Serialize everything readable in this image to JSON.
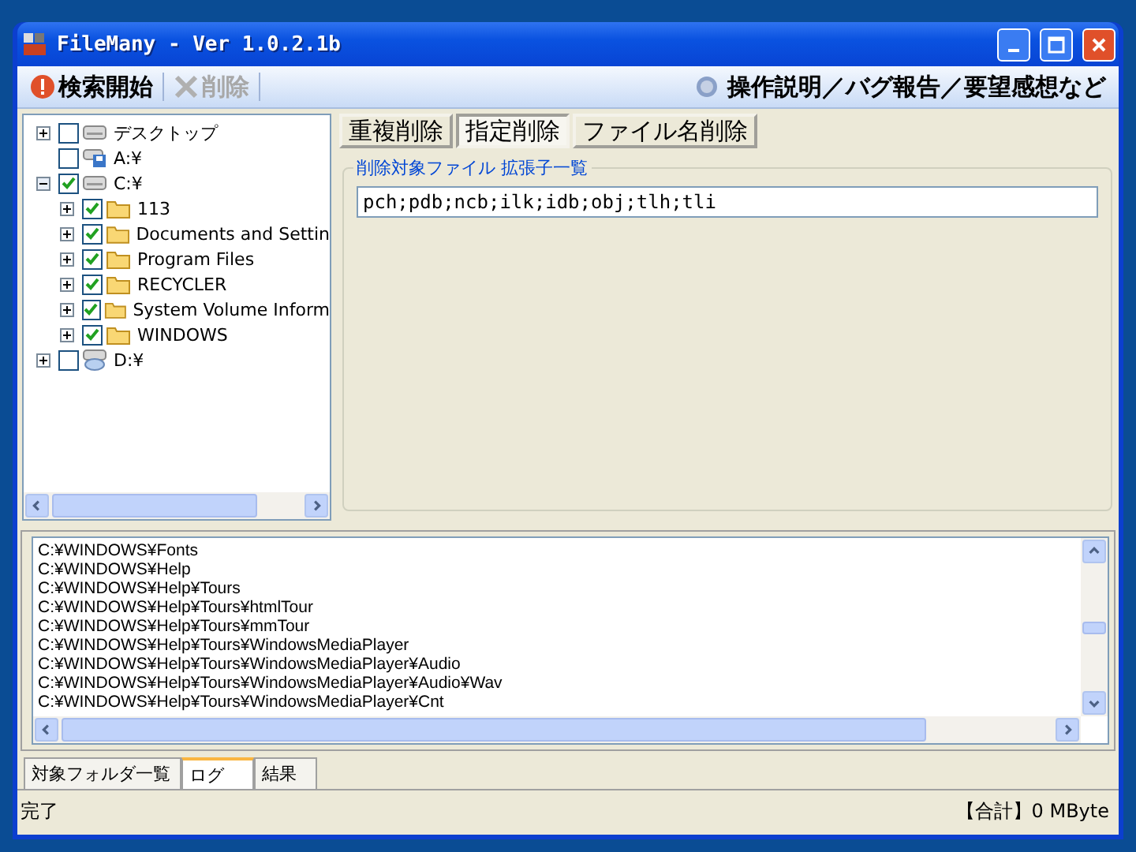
{
  "window": {
    "title": "FileMany - Ver 1.0.2.1b"
  },
  "toolbar": {
    "items": [
      {
        "label": "検索開始",
        "kind": "search",
        "disabled": false
      },
      {
        "label": "削除",
        "kind": "delete",
        "disabled": true
      }
    ],
    "help": "操作説明／バグ報告／要望感想など"
  },
  "tree": [
    {
      "label": "デスクトップ",
      "kind": "drive",
      "checked": false,
      "expanded": false
    },
    {
      "label": "A:¥",
      "kind": "floppy",
      "checked": false
    },
    {
      "label": "C:¥",
      "kind": "drive",
      "checked": true,
      "expanded": true,
      "children": [
        {
          "label": "113",
          "kind": "folder",
          "checked": true,
          "expanded": false
        },
        {
          "label": "Documents and Settin",
          "kind": "folder",
          "checked": true,
          "expanded": false
        },
        {
          "label": "Program Files",
          "kind": "folder",
          "checked": true,
          "expanded": false
        },
        {
          "label": "RECYCLER",
          "kind": "folder",
          "checked": true,
          "expanded": false
        },
        {
          "label": "System Volume Inform",
          "kind": "folder",
          "checked": true,
          "expanded": false
        },
        {
          "label": "WINDOWS",
          "kind": "folder",
          "checked": true,
          "expanded": false
        }
      ]
    },
    {
      "label": "D:¥",
      "kind": "cdrom",
      "checked": false,
      "expanded": false
    }
  ],
  "mode_tabs": [
    {
      "label": "重複削除",
      "selected": false
    },
    {
      "label": "指定削除",
      "selected": true
    },
    {
      "label": "ファイル名削除",
      "selected": false
    }
  ],
  "extensions": {
    "label": "削除対象ファイル 拡張子一覧",
    "value": "pch;pdb;ncb;ilk;idb;obj;tlh;tli"
  },
  "log": [
    "C:¥WINDOWS¥Fonts",
    "C:¥WINDOWS¥Help",
    "C:¥WINDOWS¥Help¥Tours",
    "C:¥WINDOWS¥Help¥Tours¥htmlTour",
    "C:¥WINDOWS¥Help¥Tours¥mmTour",
    "C:¥WINDOWS¥Help¥Tours¥WindowsMediaPlayer",
    "C:¥WINDOWS¥Help¥Tours¥WindowsMediaPlayer¥Audio",
    "C:¥WINDOWS¥Help¥Tours¥WindowsMediaPlayer¥Audio¥Wav",
    "C:¥WINDOWS¥Help¥Tours¥WindowsMediaPlayer¥Cnt"
  ],
  "bottom_tabs": [
    {
      "label": "対象フォルダ一覧",
      "selected": false
    },
    {
      "label": "ログ",
      "selected": true
    },
    {
      "label": "結果",
      "selected": false
    }
  ],
  "status_bar": {
    "message": "完了",
    "total": "【合計】0 MByte"
  }
}
